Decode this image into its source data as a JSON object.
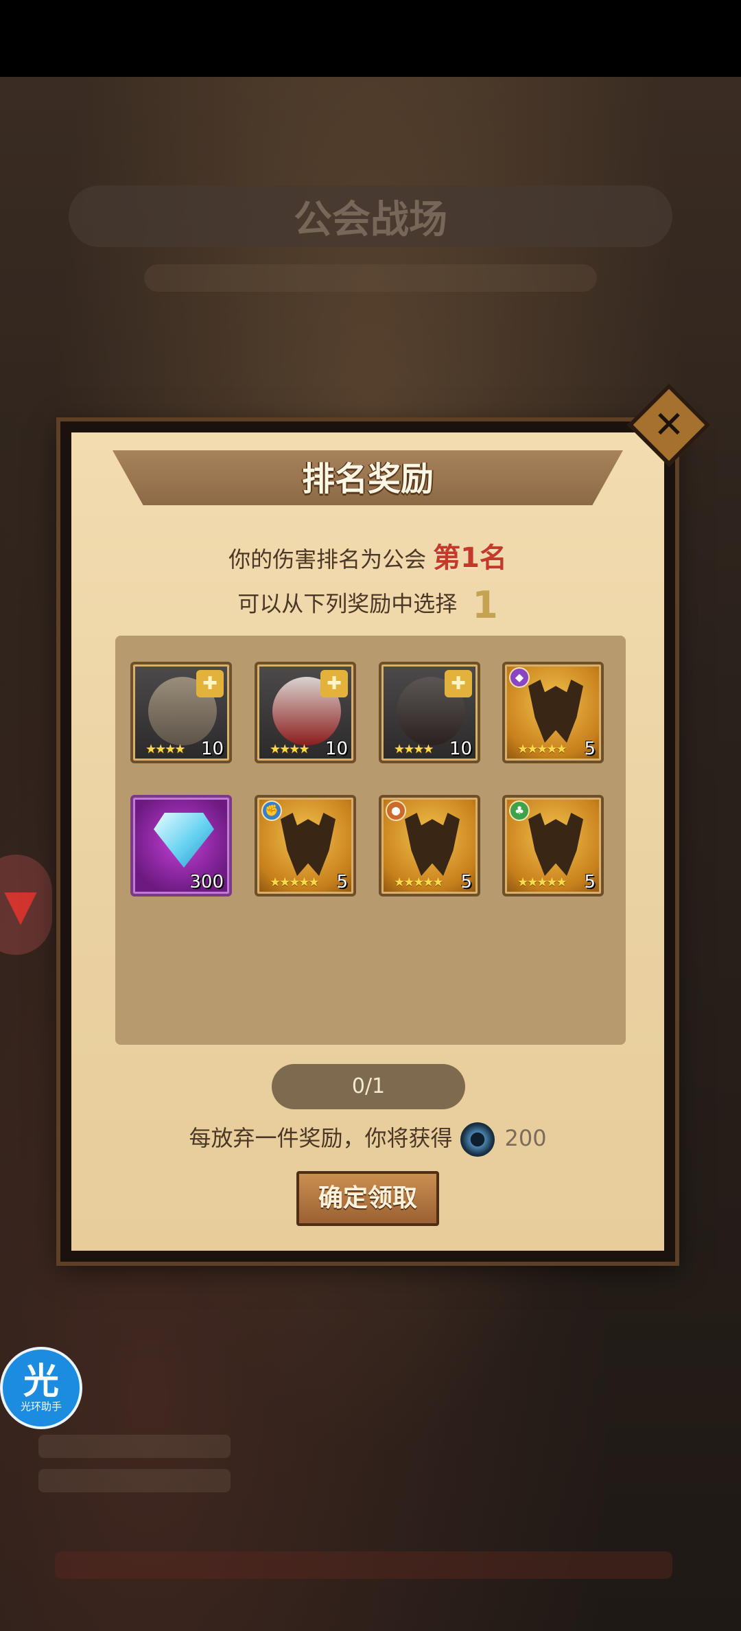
{
  "background": {
    "title": "公会战场"
  },
  "dialog": {
    "title": "排名奖励",
    "rank_prefix": "你的伤害排名为公会",
    "rank_value": "第1名",
    "choose_prefix": "可以从下列奖励中选择",
    "choose_count": "1",
    "progress": "0/1",
    "forfeit_text": "每放弃一件奖励，你将获得",
    "forfeit_amount": "200",
    "confirm_label": "确定领取",
    "close_icon": "close-icon"
  },
  "rewards": [
    {
      "type": "hero-fragment",
      "stars": "★★★★",
      "count": "10"
    },
    {
      "type": "hero-fragment",
      "stars": "★★★★",
      "count": "10"
    },
    {
      "type": "hero-fragment",
      "stars": "★★★★",
      "count": "10"
    },
    {
      "type": "equipment",
      "stars": "★★★★★",
      "count": "5",
      "badge_color": "#8a45c4"
    },
    {
      "type": "diamond",
      "count": "300"
    },
    {
      "type": "equipment",
      "stars": "★★★★★",
      "count": "5",
      "badge_color": "#3a7fc9"
    },
    {
      "type": "equipment",
      "stars": "★★★★★",
      "count": "5",
      "badge_color": "#cc6a2c"
    },
    {
      "type": "equipment",
      "stars": "★★★★★",
      "count": "5",
      "badge_color": "#3fa24a"
    }
  ],
  "helper": {
    "glyph": "光",
    "label": "光环助手"
  },
  "colors": {
    "rank_red": "#c33a2a",
    "panel": "#b79a6e",
    "dialog_bg": "#ead1a1"
  }
}
